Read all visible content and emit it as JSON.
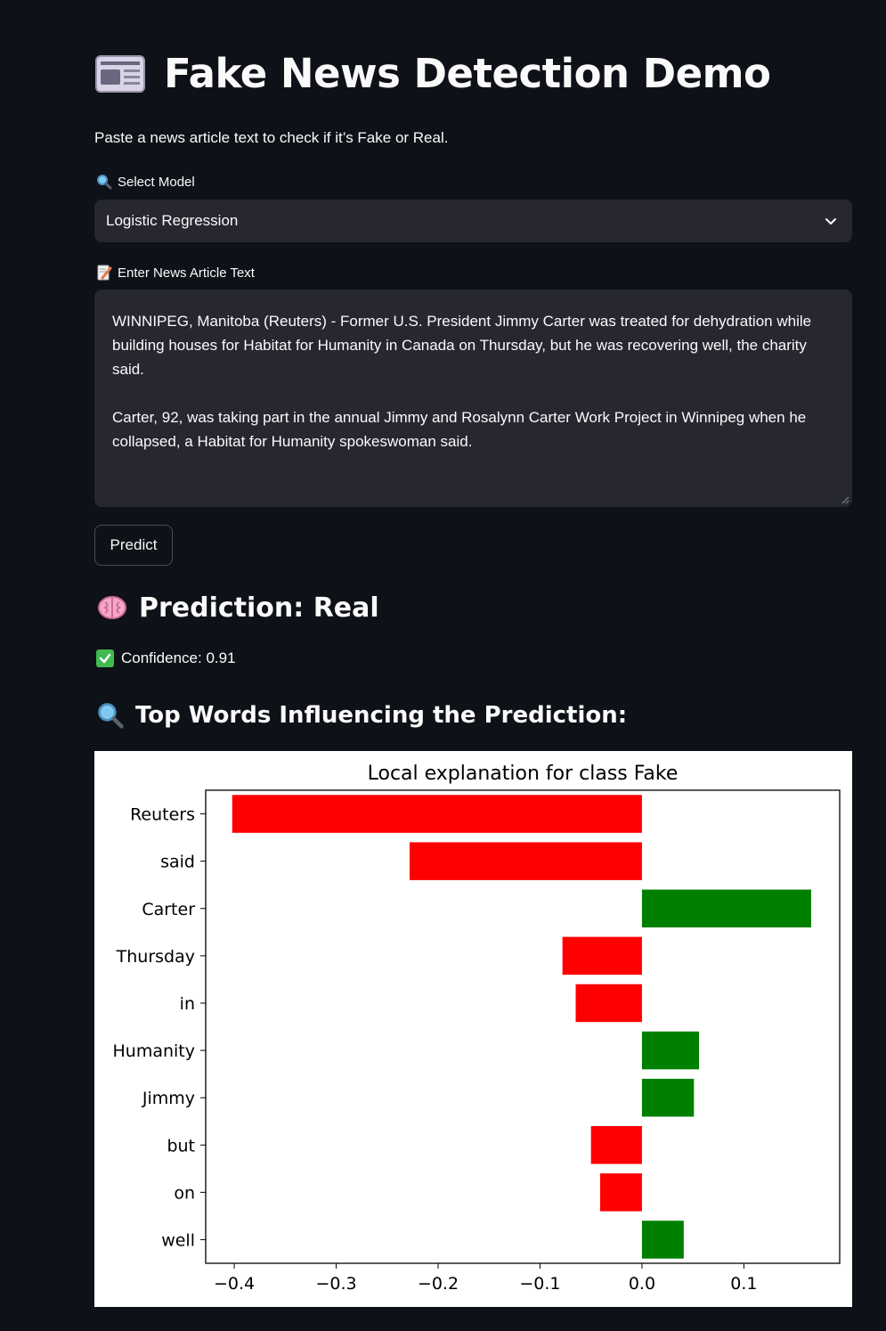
{
  "title": "Fake News Detection Demo",
  "subtitle": "Paste a news article text to check if it’s Fake or Real.",
  "model_select": {
    "label": "Select Model",
    "icon": "magnifier-icon",
    "value": "Logistic Regression"
  },
  "article_input": {
    "label": "Enter News Article Text",
    "icon": "memo-icon",
    "paragraphs": [
      "WINNIPEG, Manitoba (Reuters) - Former U.S. President Jimmy Carter was treated for dehydration while building houses for Habitat for Humanity in Canada on Thursday, but he was recovering well, the charity said.",
      "Carter, 92, was taking part in the annual Jimmy and Rosalynn Carter Work Project in Winnipeg when he collapsed, a Habitat for Humanity spokeswoman said."
    ]
  },
  "predict_button": "Predict",
  "prediction": {
    "heading": "Prediction: Real",
    "icon": "brain-icon",
    "confidence": "Confidence: 0.91",
    "confidence_icon": "check-icon"
  },
  "top_words_heading": "Top Words Influencing the Prediction:",
  "colors": {
    "background": "#0e1117",
    "input_bg": "#262730",
    "negative_bar": "#ff0000",
    "positive_bar": "#008000"
  },
  "chart_data": {
    "type": "bar",
    "orientation": "horizontal",
    "title": "Local explanation for class Fake",
    "xlabel": "",
    "ylabel": "",
    "categories": [
      "Reuters",
      "said",
      "Carter",
      "Thursday",
      "in",
      "Humanity",
      "Jimmy",
      "but",
      "on",
      "well"
    ],
    "values": [
      -0.402,
      -0.228,
      0.166,
      -0.078,
      -0.065,
      0.056,
      0.051,
      -0.05,
      -0.041,
      0.041
    ],
    "xlim": [
      -0.428,
      0.194
    ],
    "xticks": [
      -0.4,
      -0.3,
      -0.2,
      -0.1,
      0.0,
      0.1
    ],
    "xtick_labels": [
      "−0.4",
      "−0.3",
      "−0.2",
      "−0.1",
      "0.0",
      "0.1"
    ],
    "grid": false
  }
}
